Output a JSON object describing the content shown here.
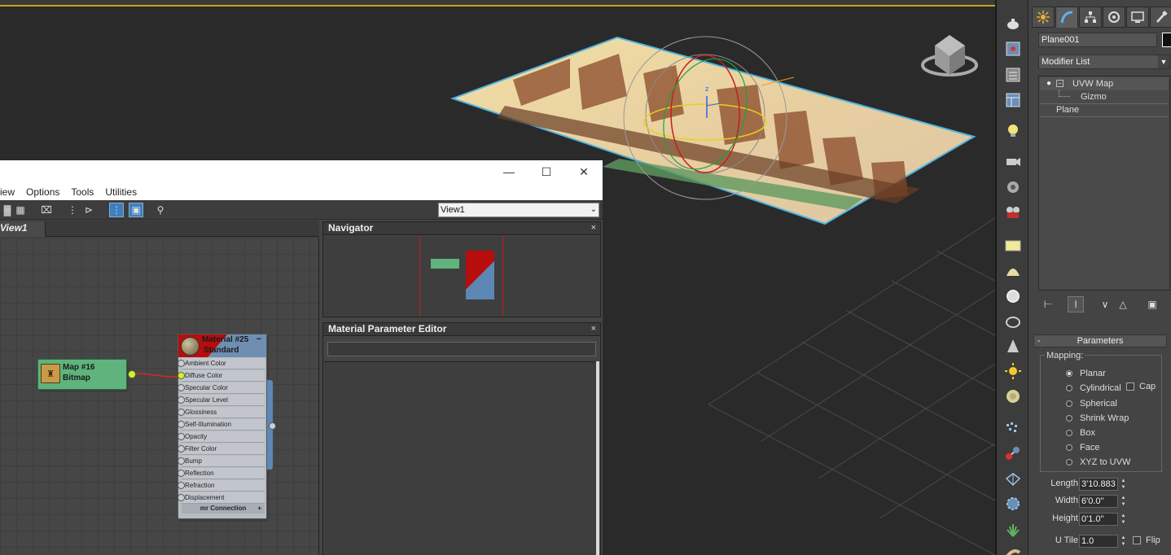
{
  "colors": {
    "accent_blue": "#3d7fc1",
    "bitmap_node": "#5fb47d",
    "material_header": "#6f8fb2",
    "material_red": "#b80d0d",
    "wire_red": "#e02424",
    "socket_hot": "#d2f03a"
  },
  "viewport": {
    "gizmo_axis_label": "z"
  },
  "icon_strip": {
    "icons": [
      "teapot-icon",
      "render-frame-icon",
      "render-setup-icon",
      "render-table-icon",
      "light-bulb-icon",
      "camera-icon",
      "audio-icon",
      "film-camera-icon",
      "plane-shape-icon",
      "dome-shape-icon",
      "sphere-shape-icon",
      "geosphere-icon",
      "cone-shape-icon",
      "sun-icon",
      "disc-icon",
      "particles-icon",
      "molecule-icon",
      "box-gizmo-icon",
      "gear-sphere-icon",
      "plant-icon",
      "tube-icon"
    ]
  },
  "command_panel": {
    "tabs": [
      "create-tab-icon",
      "modify-tab-icon",
      "hierarchy-tab-icon",
      "motion-tab-icon",
      "display-tab-icon",
      "utilities-tab-icon"
    ],
    "object_name": "Plane001",
    "modifier_list_label": "Modifier List",
    "stack": {
      "modifier": "UVW Map",
      "sub_object": "Gizmo",
      "base_object": "Plane"
    },
    "parameters": {
      "rollout_title": "Parameters",
      "group_label": "Mapping:",
      "options": [
        {
          "label": "Planar",
          "selected": true
        },
        {
          "label": "Cylindrical",
          "selected": false
        },
        {
          "label": "Spherical",
          "selected": false
        },
        {
          "label": "Shrink Wrap",
          "selected": false
        },
        {
          "label": "Box",
          "selected": false
        },
        {
          "label": "Face",
          "selected": false
        },
        {
          "label": "XYZ to UVW",
          "selected": false
        }
      ],
      "cap_label": "Cap",
      "length_label": "Length:",
      "length_value": "3'10.883",
      "width_label": "Width:",
      "width_value": "6'0.0\"",
      "height_label": "Height:",
      "height_value": "0'1.0\"",
      "utile_label": "U Tile:",
      "utile_value": "1.0",
      "flip_label": "Flip"
    }
  },
  "slate": {
    "menu": [
      "iew",
      "Options",
      "Tools",
      "Utilities"
    ],
    "view_select": "View1",
    "view_tab": "View1",
    "navigator": {
      "title": "Navigator",
      "close": "×"
    },
    "mpe": {
      "title": "Material Parameter Editor",
      "close": "×"
    },
    "bitmap_node": {
      "name": "Map #16",
      "type": "Bitmap"
    },
    "material_node": {
      "name": "Material #25",
      "type": "Standard",
      "collapse": "−",
      "slots": [
        "Ambient Color",
        "Diffuse Color",
        "Specular Color",
        "Specular Level",
        "Glossiness",
        "Self-Illumination",
        "Opacity",
        "Filter Color",
        "Bump",
        "Reflection",
        "Refraction",
        "Displacement"
      ],
      "mr_connection": "mr Connection",
      "mr_plus": "+"
    }
  }
}
